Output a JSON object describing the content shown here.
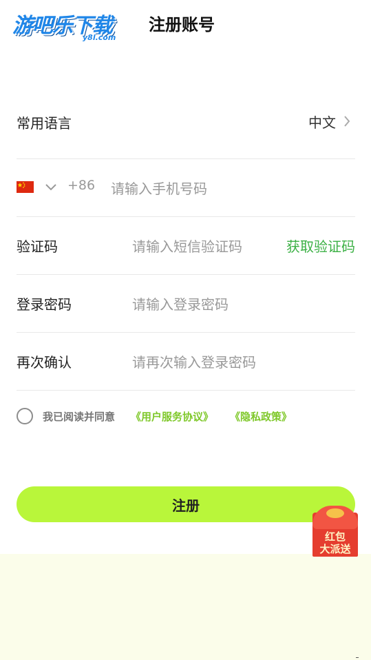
{
  "header": {
    "logo_text": "游吧乐下载",
    "logo_sub": "y8l.com",
    "title": "注册账号"
  },
  "form": {
    "language": {
      "label": "常用语言",
      "value": "中文",
      "chevron_icon": "chevron-right-icon"
    },
    "phone": {
      "flag_icon": "china-flag-icon",
      "dropdown_icon": "chevron-down-icon",
      "country_code": "+86",
      "placeholder": "请输入手机号码"
    },
    "verification": {
      "label": "验证码",
      "placeholder": "请输入短信验证码",
      "get_code": "获取验证码"
    },
    "password": {
      "label": "登录密码",
      "placeholder": "请输入登录密码"
    },
    "confirm": {
      "label": "再次确认",
      "placeholder": "请再次输入登录密码"
    }
  },
  "agreement": {
    "text": "我已阅读并同意",
    "user_agreement": "《用户服务协议》",
    "privacy_policy": "《隐私政策》"
  },
  "submit_label": "注册",
  "red_packet": {
    "line1": "红包",
    "line2": "大派送"
  },
  "colors": {
    "accent_green": "#b9f63a",
    "link_green": "#7fc82a",
    "get_code_green": "#3bb044",
    "background": "#fbfdea"
  }
}
